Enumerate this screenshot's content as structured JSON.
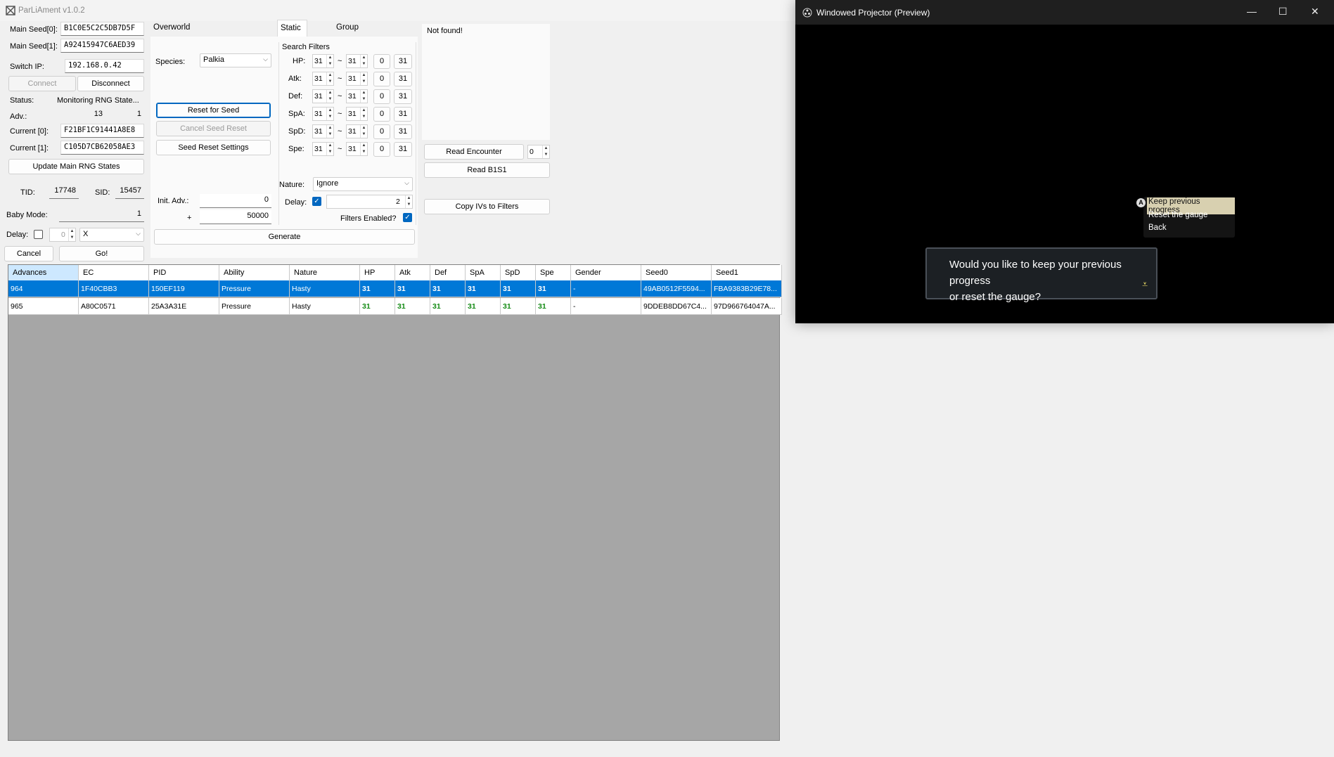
{
  "app": {
    "title": "ParLiAment v1.0.2"
  },
  "left": {
    "main_seed0_label": "Main Seed[0]:",
    "main_seed0": "B1C0E5C2C5DB7D5F",
    "main_seed1_label": "Main Seed[1]:",
    "main_seed1": "A92415947C6AED39",
    "switch_ip_label": "Switch IP:",
    "switch_ip": "192.168.0.42",
    "connect": "Connect",
    "disconnect": "Disconnect",
    "status_label": "Status:",
    "status": "Monitoring RNG State...",
    "adv_label": "Adv.:",
    "adv_a": "13",
    "adv_b": "1",
    "current0_label": "Current [0]:",
    "current0": "F21BF1C91441A8E8",
    "current1_label": "Current [1]:",
    "current1": "C105D7CB62058AE3",
    "update": "Update Main RNG States",
    "tid_label": "TID:",
    "tid": "17748",
    "sid_label": "SID:",
    "sid": "15457",
    "baby_label": "Baby Mode:",
    "baby": "1",
    "delay_label": "Delay:",
    "delay_val": "0",
    "delay_key": "X",
    "cancel": "Cancel",
    "go": "Go!"
  },
  "tabs": [
    "Overworld Legendary (Spawner)",
    "Static (Main)",
    "Group Seed Solver"
  ],
  "spawner": {
    "species_label": "Species:",
    "species": "Palkia",
    "reset_for_seed": "Reset for Seed",
    "cancel_seed_reset": "Cancel Seed Reset",
    "seed_reset_settings": "Seed Reset Settings",
    "init_adv_label": "Init. Adv.:",
    "init_adv": "0",
    "plus_label": "+",
    "plus": "50000",
    "generate": "Generate"
  },
  "filters": {
    "title": "Search Filters",
    "stats": [
      {
        "name": "HP:",
        "min": "31",
        "tilde": "~",
        "max": "31",
        "a": "0",
        "b": "31"
      },
      {
        "name": "Atk:",
        "min": "31",
        "tilde": "~",
        "max": "31",
        "a": "0",
        "b": "31"
      },
      {
        "name": "Def:",
        "min": "31",
        "tilde": "~",
        "max": "31",
        "a": "0",
        "b": "31"
      },
      {
        "name": "SpA:",
        "min": "31",
        "tilde": "~",
        "max": "31",
        "a": "0",
        "b": "31"
      },
      {
        "name": "SpD:",
        "min": "31",
        "tilde": "~",
        "max": "31",
        "a": "0",
        "b": "31"
      },
      {
        "name": "Spe:",
        "min": "31",
        "tilde": "~",
        "max": "31",
        "a": "0",
        "b": "31"
      }
    ],
    "nature_label": "Nature:",
    "nature": "Ignore",
    "delay_label": "Delay:",
    "delay": "2",
    "filters_enabled": "Filters Enabled?"
  },
  "right": {
    "not_found": "Not found!",
    "read_encounter": "Read Encounter",
    "encounter_idx": "0",
    "read_b1s1": "Read B1S1",
    "copy_ivs": "Copy IVs to Filters"
  },
  "table": {
    "headers": [
      "Advances",
      "EC",
      "PID",
      "Ability",
      "Nature",
      "HP",
      "Atk",
      "Def",
      "SpA",
      "SpD",
      "Spe",
      "Gender",
      "Seed0",
      "Seed1"
    ],
    "rows": [
      [
        "964",
        "1F40CBB3",
        "150EF119",
        "Pressure",
        "Hasty",
        "31",
        "31",
        "31",
        "31",
        "31",
        "31",
        "-",
        "49AB0512F5594...",
        "FBA9383B29E78..."
      ],
      [
        "965",
        "A80C0571",
        "25A3A31E",
        "Pressure",
        "Hasty",
        "31",
        "31",
        "31",
        "31",
        "31",
        "31",
        "-",
        "9DDEB8DD67C4...",
        "97D966764047A..."
      ]
    ]
  },
  "projector": {
    "title": "Windowed Projector (Preview)",
    "menu": [
      "Keep previous progress",
      "Reset the gauge",
      "Back"
    ],
    "menu_key": "A",
    "dialog_line1": "Would you like to keep your previous progress",
    "dialog_line2": "or reset the gauge?"
  },
  "colors": {
    "selection": "#0078d7",
    "iv_green": "#138a13",
    "accent": "#0067c0"
  }
}
